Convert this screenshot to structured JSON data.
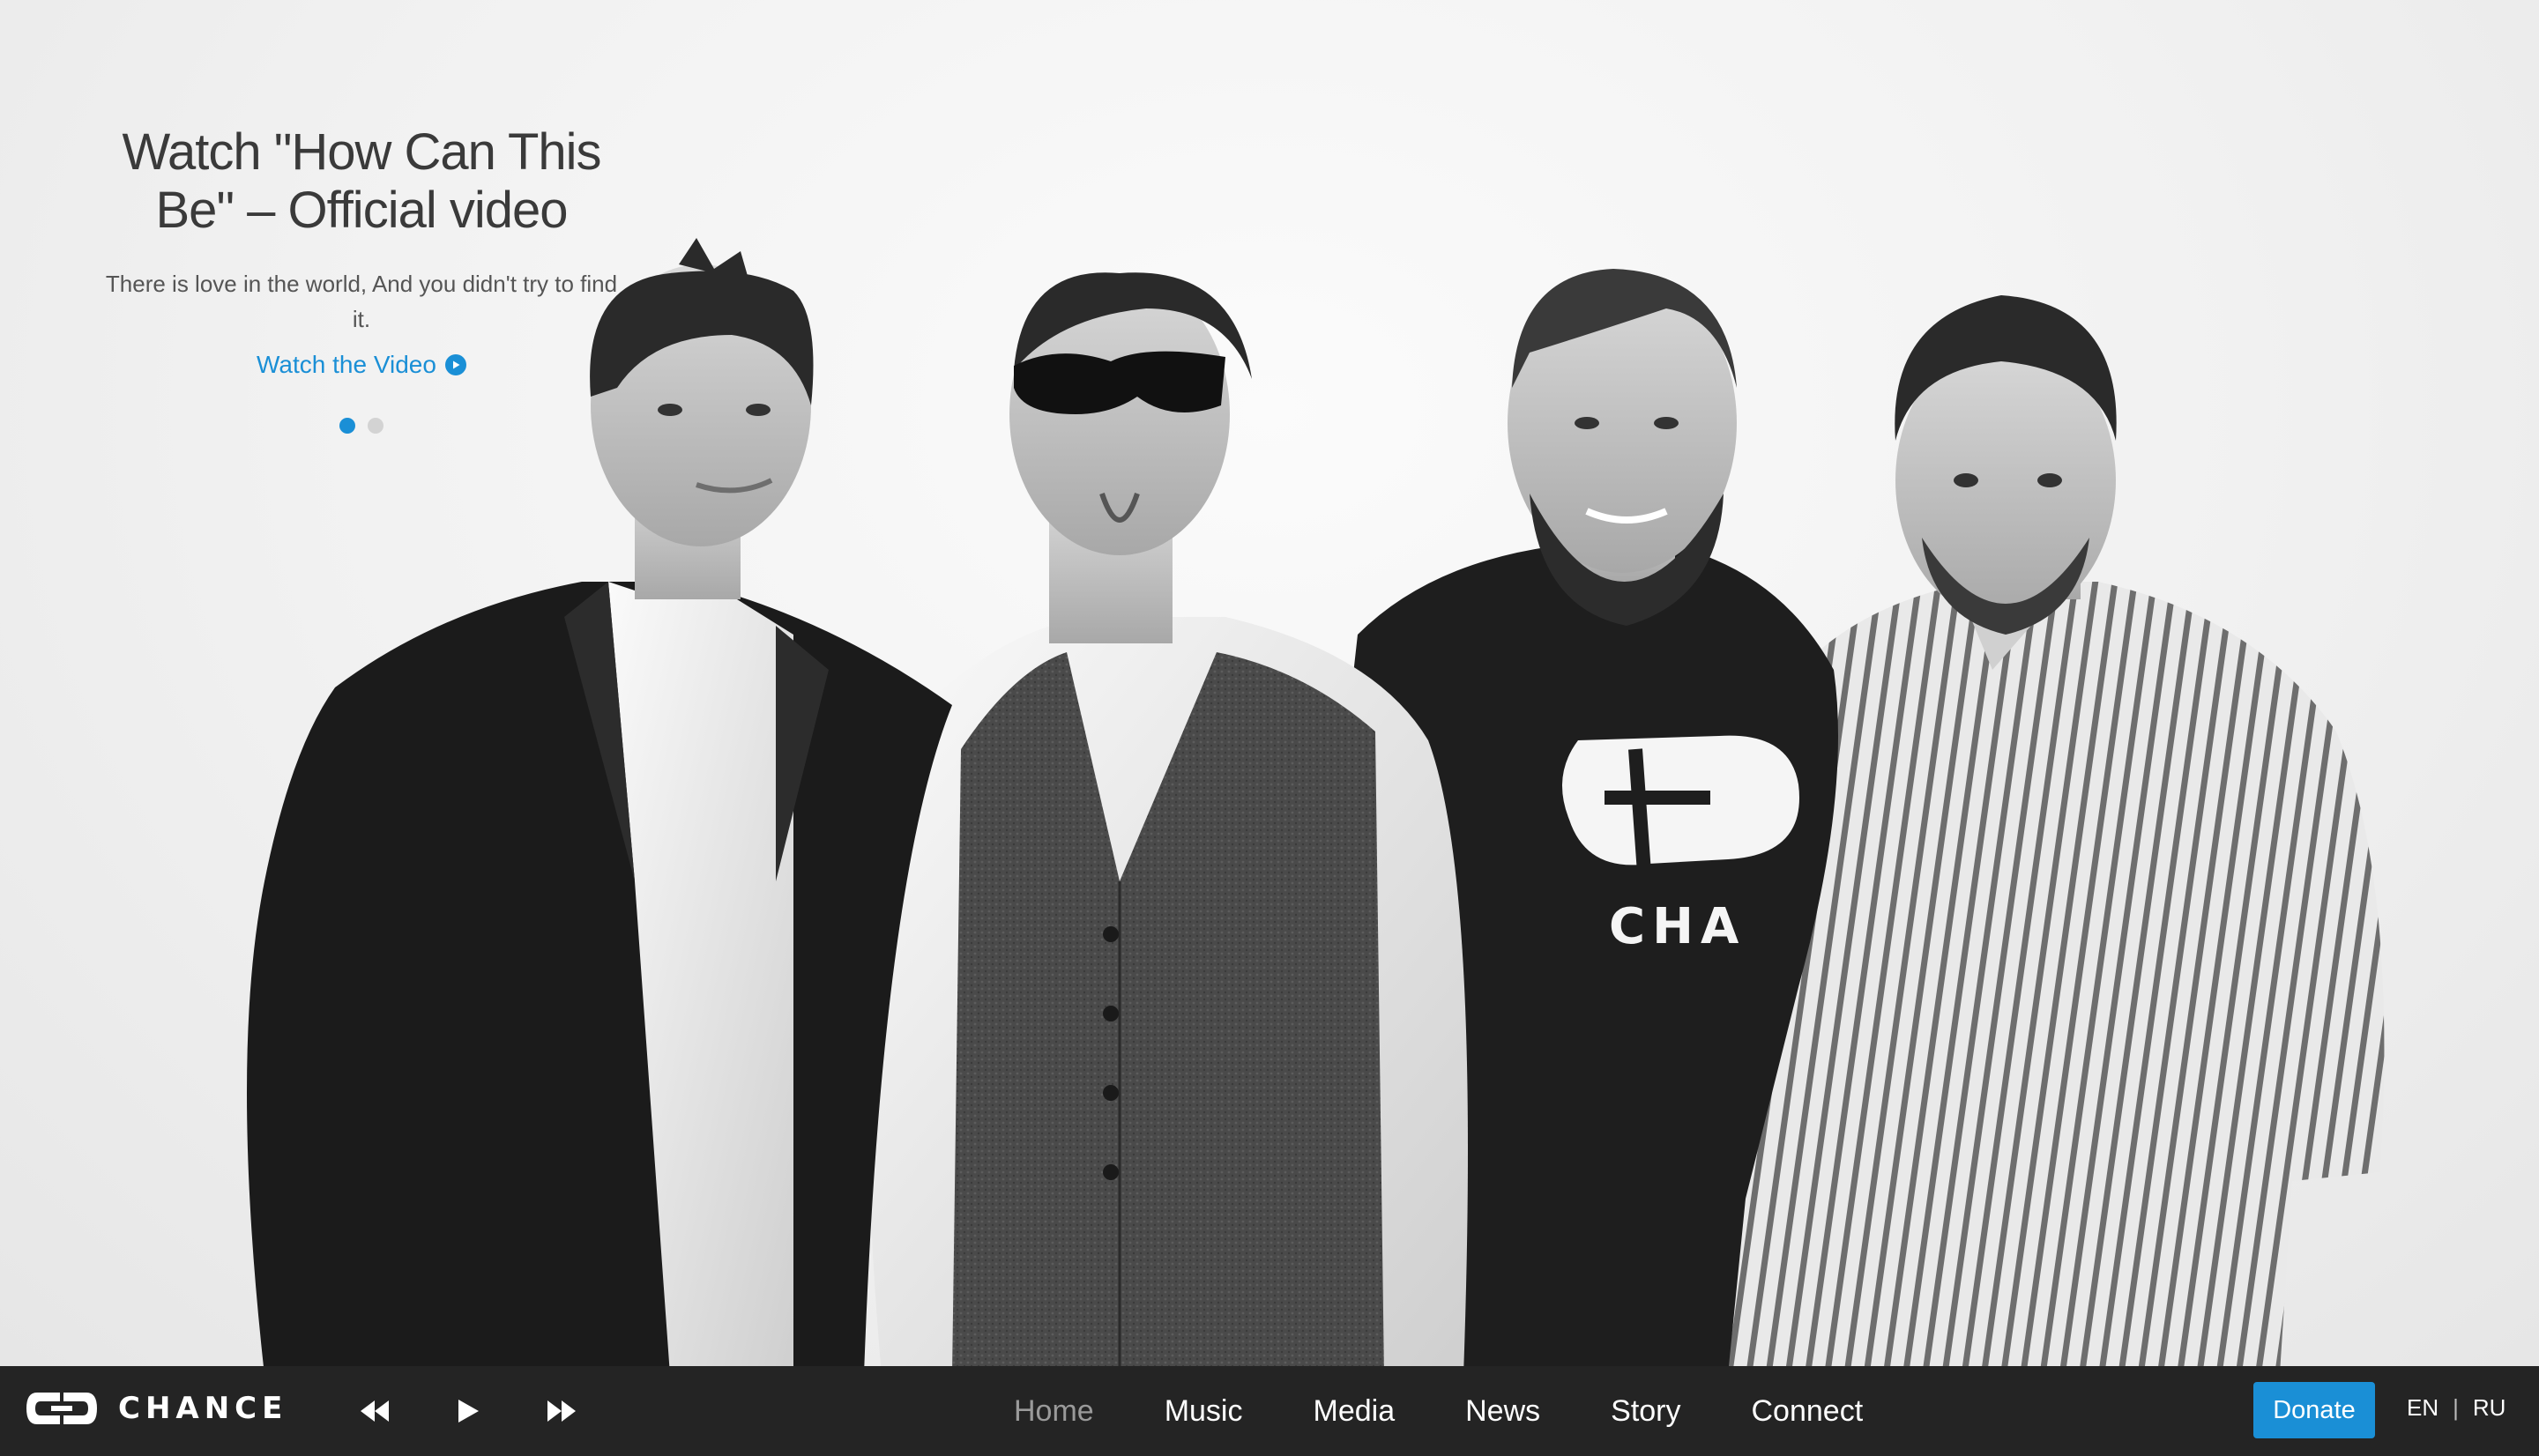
{
  "hero": {
    "title": "Watch \"How Can This Be\" – Official video",
    "text": "There is love in the world, And you didn't try to find it.",
    "link_label": "Watch the Video",
    "link_icon": "play-circle-icon",
    "slides_total": 2,
    "slide_active": 1,
    "shirt_logo_text": "CHA"
  },
  "brand": {
    "name": "CHANCE",
    "logo_icon": "chance-logo-icon"
  },
  "player": {
    "prev_icon": "rewind-icon",
    "play_icon": "play-icon",
    "next_icon": "fast-forward-icon"
  },
  "nav": {
    "items": [
      "Home",
      "Music",
      "Media",
      "News",
      "Story",
      "Connect"
    ],
    "current": "Home"
  },
  "donate_label": "Donate",
  "languages": {
    "en": "EN",
    "separator": "|",
    "ru": "RU"
  },
  "colors": {
    "accent": "#1a8fd6",
    "bar_bg": "#161616",
    "nav_current": "#9a9a9a",
    "text": "#3a3a3a"
  }
}
